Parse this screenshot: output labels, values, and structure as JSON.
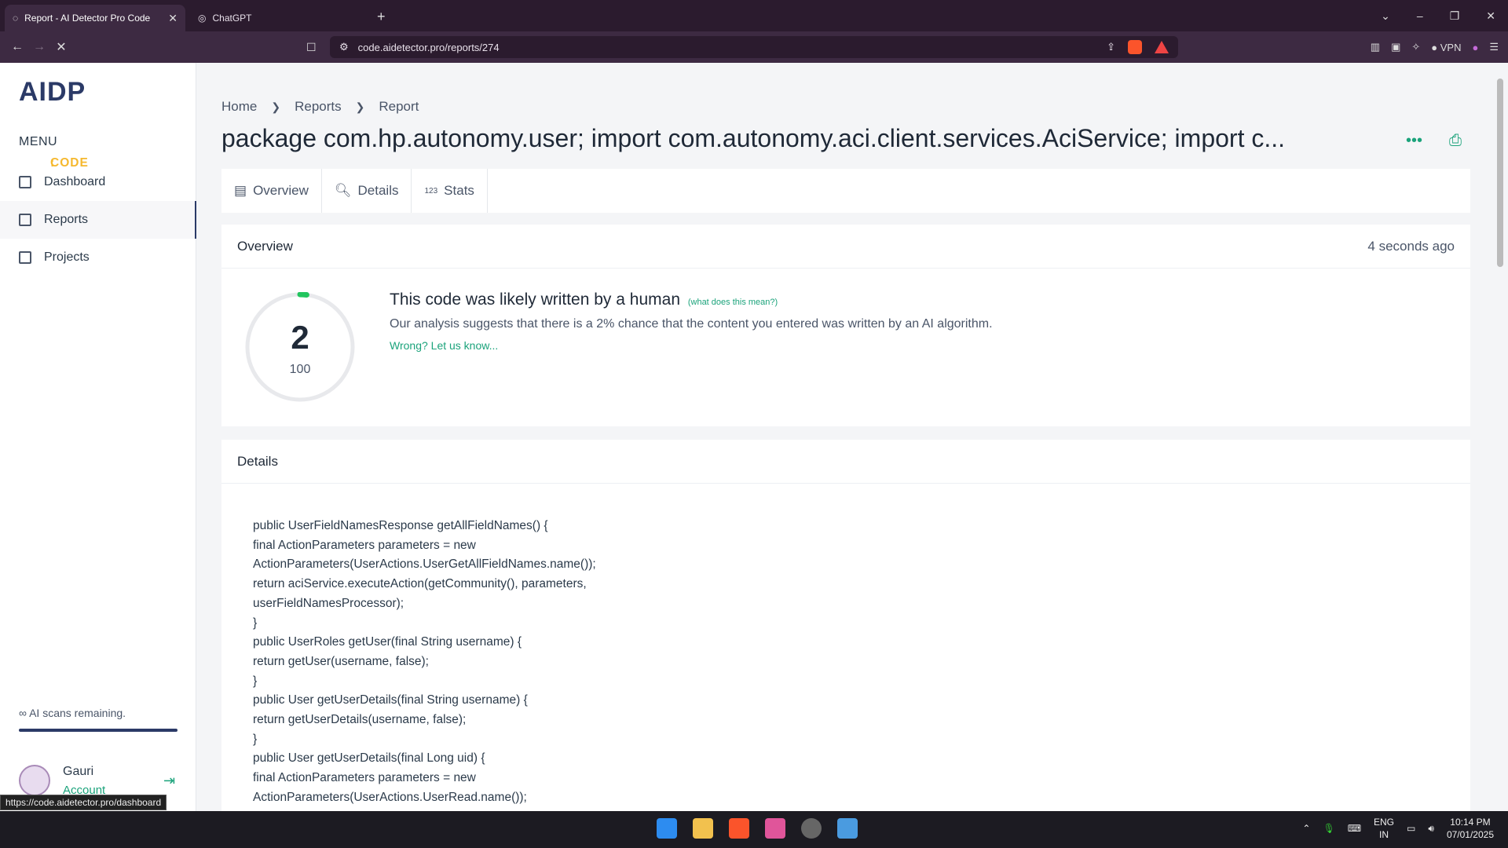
{
  "browser": {
    "tabs": [
      {
        "title": "Report - AI Detector Pro Code",
        "active": true
      },
      {
        "title": "ChatGPT",
        "active": false
      }
    ],
    "url": "code.aidetector.pro/reports/274",
    "vpn_label": "VPN",
    "status_url": "https://code.aidetector.pro/dashboard"
  },
  "sidebar": {
    "logo": {
      "left": "AIDP",
      "sep": ":",
      "right": "CODE"
    },
    "menu_label": "MENU",
    "items": [
      {
        "label": "Dashboard",
        "icon": "grid-icon"
      },
      {
        "label": "Reports",
        "icon": "list-icon"
      },
      {
        "label": "Projects",
        "icon": "nodes-icon"
      }
    ],
    "scans_text": "∞ AI scans remaining.",
    "user": {
      "name": "Gauri",
      "account": "Account"
    }
  },
  "main": {
    "breadcrumb": [
      "Home",
      "Reports",
      "Report"
    ],
    "title": "package com.hp.autonomy.user; import com.autonomy.aci.client.services.AciService; import c...",
    "tabs": [
      {
        "label": "Overview",
        "icon": "table-icon"
      },
      {
        "label": "Details",
        "icon": "search-icon"
      },
      {
        "label": "Stats",
        "icon": "123-icon"
      }
    ],
    "overview": {
      "heading": "Overview",
      "time": "4 seconds ago",
      "score": "2",
      "score_max": "100",
      "score_fraction": 0.02,
      "result_title": "This code was likely written by a human",
      "help_link": "(what does this mean?)",
      "description": "Our analysis suggests that there is a 2% chance that the content you entered was written by an AI algorithm.",
      "feedback_link": "Wrong? Let us know..."
    },
    "details": {
      "heading": "Details",
      "code_lines": [
        "public UserFieldNamesResponse getAllFieldNames() {",
        "final ActionParameters parameters = new",
        "ActionParameters(UserActions.UserGetAllFieldNames.name());",
        "return aciService.executeAction(getCommunity(), parameters,",
        "userFieldNamesProcessor);",
        "}",
        "public UserRoles getUser(final String username) {",
        "return getUser(username, false);",
        "}",
        "public User getUserDetails(final String username) {",
        "return getUserDetails(username, false);",
        "}",
        "public User getUserDetails(final Long uid) {",
        "final ActionParameters parameters = new",
        "ActionParameters(UserActions.UserRead.name());"
      ]
    }
  },
  "taskbar": {
    "lang": "ENG",
    "region": "IN",
    "time": "10:14 PM",
    "date": "07/01/2025"
  },
  "colors": {
    "accent": "#1ba37b",
    "brand": "#2b3a67",
    "logo_accent": "#f5b82e"
  }
}
